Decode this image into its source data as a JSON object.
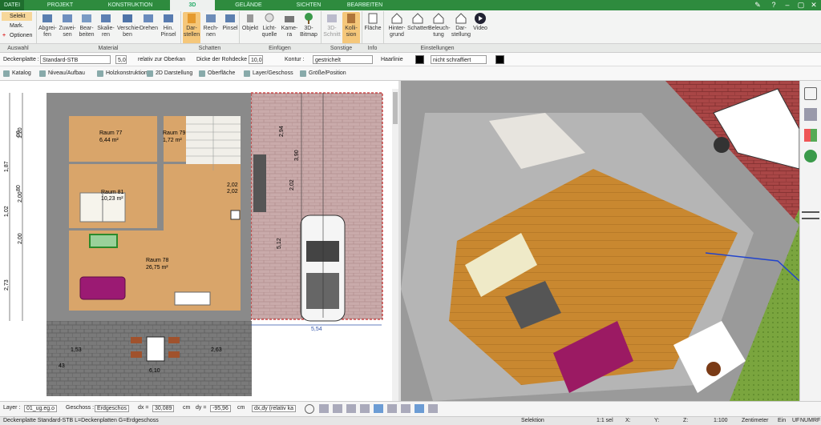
{
  "tabs": {
    "datei": "DATEI",
    "projekt": "PROJEKT",
    "konstruktion": "KONSTRUKTION",
    "d3": "3D",
    "gelaende": "GELÄNDE",
    "sichten": "SICHTEN",
    "bearbeiten": "BEARBEITEN"
  },
  "auswahl": {
    "selekt": "Selekt",
    "mark": "Mark.",
    "optionen": "Optionen"
  },
  "ribbon": {
    "abgreifen": "Abgrei-\nfen",
    "zuweisen": "Zuwei-\nsen",
    "bearbeiten": "Bear-\nbeiten",
    "skalieren": "Skalie-\nren",
    "verschieben": "Verschie-\nben",
    "drehen": "Drehen",
    "hinpinsel": "Hin.\nPinsel",
    "darstellen": "Dar-\nstellen",
    "rechnen": "Rech-\nnen",
    "pinsel": "Pinsel",
    "objekt": "Objekt",
    "lichtquelle": "Licht-\nquelle",
    "kamera": "Kame-\nra",
    "bitmap": "3D-\nBitmap",
    "schnitt": "3D-\nSchnitt",
    "kollision": "Kolli-\nsion",
    "flaeche": "Fläche",
    "hintergrund": "Hinter-\ngrund",
    "schatten": "Schatten",
    "beleuchtung": "Beleuch-\ntung",
    "darstellung": "Dar-\nstellung",
    "video": "Video"
  },
  "groups": {
    "auswahl": "Auswahl",
    "material": "Material",
    "schatten": "Schatten",
    "einfuegen": "Einfügen",
    "sonstige": "Sonstige",
    "info": "Info",
    "einstellungen": "Einstellungen"
  },
  "propbar": {
    "deckenplatte": "Deckenplatte :",
    "standard": "Standard-STB",
    "dicke": "5,0",
    "relativ": "relativ zur Oberkan",
    "dicke_rohdecke": "Dicke der Rohdecke",
    "rohwert": "10,0",
    "kontur": "Kontur :",
    "gestrichelt": "gestrichelt",
    "haarlinie": "Haarlinie",
    "schraffiert": "nicht schraffiert"
  },
  "toolbar2": {
    "katalog": "Katalog",
    "niveau": "Niveau/Aufbau",
    "holz": "Holzkonstruktion",
    "darst2d": "2D Darstellung",
    "oberflaeche": "Oberfläche",
    "layer": "Layer/Geschoss",
    "groesse": "Größe/Position"
  },
  "plan": {
    "raum77": "Raum 77",
    "raum77a": "6,44 m²",
    "raum79": "Raum 79",
    "raum79a": "1,72 m²",
    "raum81": "Raum 81",
    "raum81a": "10,23 m²",
    "raum78": "Raum 78",
    "raum78a": "26,75 m²",
    "d1": "5,54",
    "d2": "6,10",
    "d3": "5,12",
    "d4": "2,94",
    "d5": "3,90",
    "d6": "2,02",
    "d7": "2,73",
    "d8": "2,02",
    "d9": "1,87",
    "d10": "1,20",
    "d11": "2,00",
    "d12": "1,53",
    "d13": "2,63",
    "d14": "90",
    "d15": "80",
    "d16": "43",
    "d17": "1,02",
    "d18": "2,00",
    "d19": "2,02"
  },
  "bottom": {
    "layer_lbl": "Layer :",
    "layer_val": "01_ug.eg.o",
    "geschoss_lbl": "Geschoss :",
    "geschoss_val": "Erdgeschos",
    "dx_lbl": "dx =",
    "dx_val": "30,089",
    "cm1": "cm",
    "dy_lbl": "dy =",
    "dy_val": "-95,96",
    "cm2": "cm",
    "dxdy": "dx,dy (relativ ka"
  },
  "status": {
    "left": "Deckenplatte Standard-STB L=Deckenplatten G=Erdgeschoss",
    "mode": "Selektion",
    "scale": "1:1 sel",
    "x": "X:",
    "y": "Y:",
    "z": "Z:",
    "ratio": "1:100",
    "unit": "Zentimeter",
    "ein": "Ein",
    "uf": "UF",
    "num": "NUM",
    "rf": "RF"
  }
}
